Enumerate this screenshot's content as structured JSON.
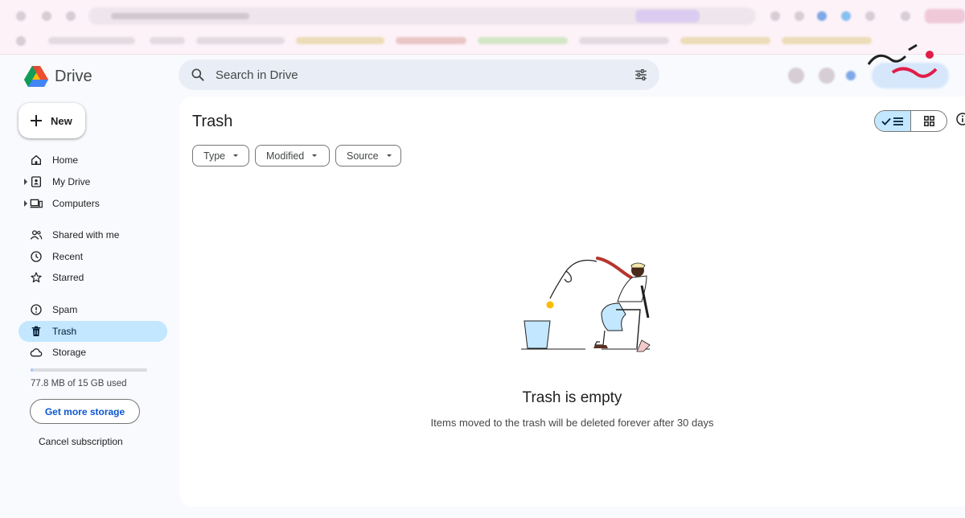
{
  "app": {
    "name": "Drive"
  },
  "search": {
    "placeholder": "Search in Drive"
  },
  "sidebar": {
    "new_label": "New",
    "items": [
      {
        "label": "Home",
        "icon": "home-icon"
      },
      {
        "label": "My Drive",
        "icon": "my-drive-icon"
      },
      {
        "label": "Computers",
        "icon": "computers-icon"
      },
      {
        "label": "Shared with me",
        "icon": "shared-icon"
      },
      {
        "label": "Recent",
        "icon": "recent-icon"
      },
      {
        "label": "Starred",
        "icon": "star-icon"
      },
      {
        "label": "Spam",
        "icon": "spam-icon"
      },
      {
        "label": "Trash",
        "icon": "trash-icon",
        "active": true
      },
      {
        "label": "Storage",
        "icon": "cloud-icon"
      }
    ],
    "storage_text": "77.8 MB of 15 GB used",
    "storage_fraction": 0.005,
    "get_more_storage": "Get more storage",
    "cancel_subscription": "Cancel subscription"
  },
  "main": {
    "title": "Trash",
    "filters": [
      "Type",
      "Modified",
      "Source"
    ],
    "empty_title": "Trash is empty",
    "empty_subtitle": "Items moved to the trash will be deleted forever after 30 days"
  },
  "colors": {
    "accent": "#c2e7ff",
    "link": "#0b57d0",
    "search_bg": "#e9eef6"
  }
}
